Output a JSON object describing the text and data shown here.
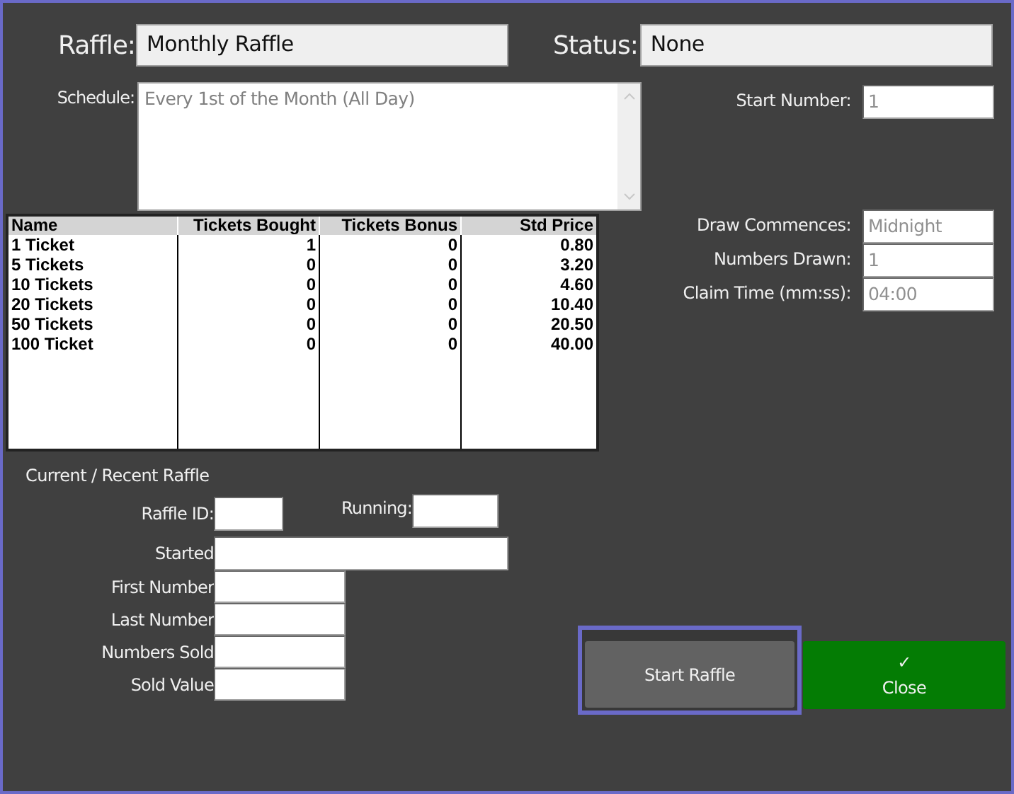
{
  "raffle": {
    "label": "Raffle:",
    "value": "Monthly Raffle"
  },
  "status": {
    "label": "Status:",
    "value": "None"
  },
  "schedule": {
    "label": "Schedule:",
    "value": "Every 1st of the Month (All Day)"
  },
  "start_number": {
    "label": "Start Number:",
    "value": "1"
  },
  "table": {
    "columns": [
      "Name",
      "Tickets Bought",
      "Tickets Bonus",
      "Std Price"
    ],
    "rows": [
      [
        "1 Ticket",
        "1",
        "0",
        "0.80"
      ],
      [
        "5 Tickets",
        "0",
        "0",
        "3.20"
      ],
      [
        "10 Tickets",
        "0",
        "0",
        "4.60"
      ],
      [
        "20 Tickets",
        "0",
        "0",
        "10.40"
      ],
      [
        "50 Tickets",
        "0",
        "0",
        "20.50"
      ],
      [
        "100 Ticket",
        "0",
        "0",
        "40.00"
      ]
    ]
  },
  "draw_settings": [
    {
      "label": "Draw Commences:",
      "value": "Midnight"
    },
    {
      "label": "Numbers Drawn:",
      "value": "1"
    },
    {
      "label": "Claim Time (mm:ss):",
      "value": "04:00"
    }
  ],
  "current": {
    "title": "Current / Recent Raffle",
    "raffle_id": {
      "label": "Raffle ID:"
    },
    "running": {
      "label": "Running:"
    },
    "started": {
      "label": "Started"
    },
    "fields": [
      {
        "label": "First Number"
      },
      {
        "label": "Last Number"
      },
      {
        "label": "Numbers Sold"
      },
      {
        "label": "Sold Value"
      }
    ]
  },
  "buttons": [
    {
      "kind": "neutral",
      "label": "Start Raffle",
      "focused": true
    },
    {
      "kind": "confirm",
      "label": "Close",
      "icon": "✓",
      "focused": false
    }
  ]
}
